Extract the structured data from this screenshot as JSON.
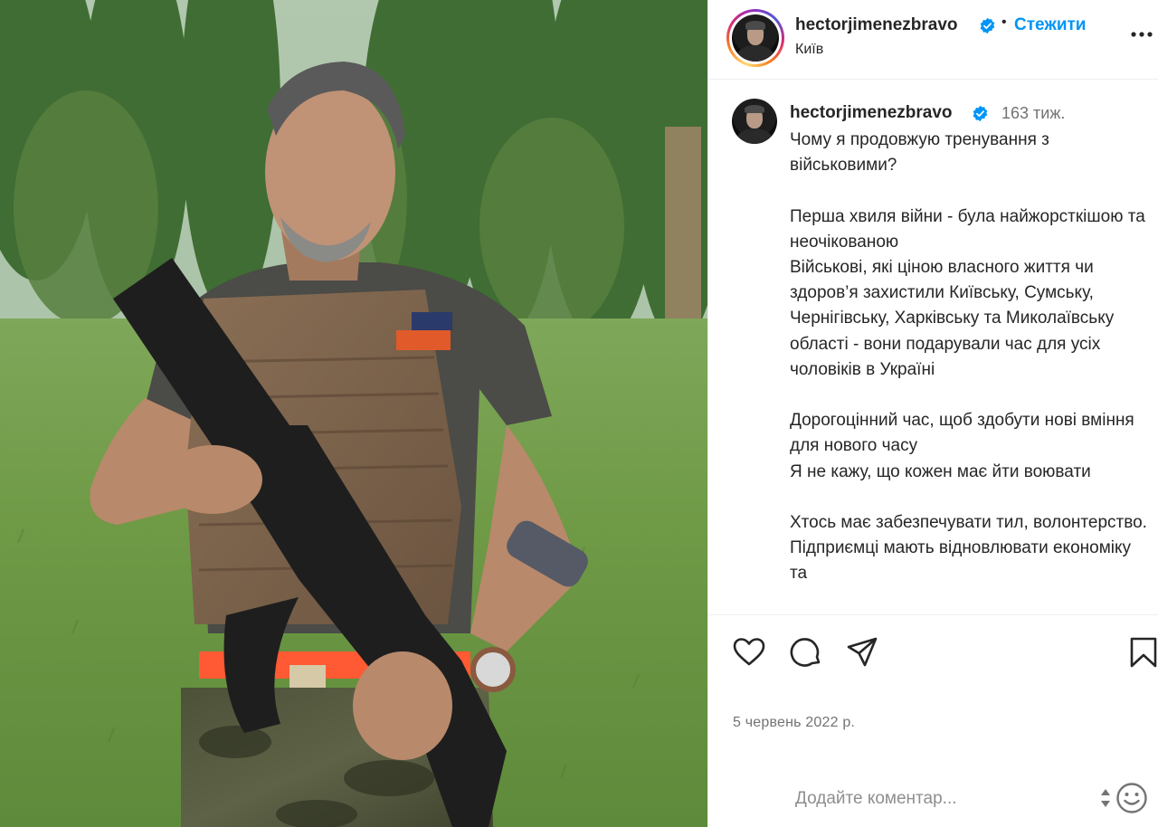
{
  "post": {
    "image_alt": "Man in tactical vest holding a rifle in a park"
  },
  "header": {
    "username": "hectorjimenezbravo",
    "separator": "•",
    "follow_label": "Стежити",
    "location": "Київ",
    "avatar_icon": "profile-avatar",
    "verified_icon": "verified-badge-icon",
    "more_icon": "more-options-icon"
  },
  "caption": {
    "username": "hectorjimenezbravo",
    "time_ago": "163 тиж.",
    "text": "Чому я продовжую тренування з військовими?\n\nПерша хвиля війни - була найжорсткішою та неочікованою\nВійськові, які ціною власного життя чи здоров’я захистили Київську, Сумську, Чернігівську, Харківську та Миколаївську області - вони подарували час для усіх чоловіків в Україні\n\nДорогоцінний час, щоб здобути нові вміння для нового часу\nЯ не кажу, що кожен має йти воювати\n\nХтось має забезпечувати тил, волонтерство. Підприємці мають відновлювати економіку та"
  },
  "actions": {
    "like_icon": "heart-icon",
    "comment_icon": "comment-icon",
    "share_icon": "share-icon",
    "save_icon": "bookmark-icon"
  },
  "date": "5 червень 2022 р.",
  "comment": {
    "placeholder": "Додайте коментар...",
    "emoji_icon": "emoji-icon"
  },
  "colors": {
    "accent": "#0095f6",
    "text": "#262626",
    "secondary": "#737373",
    "verified": "#0095f6"
  }
}
